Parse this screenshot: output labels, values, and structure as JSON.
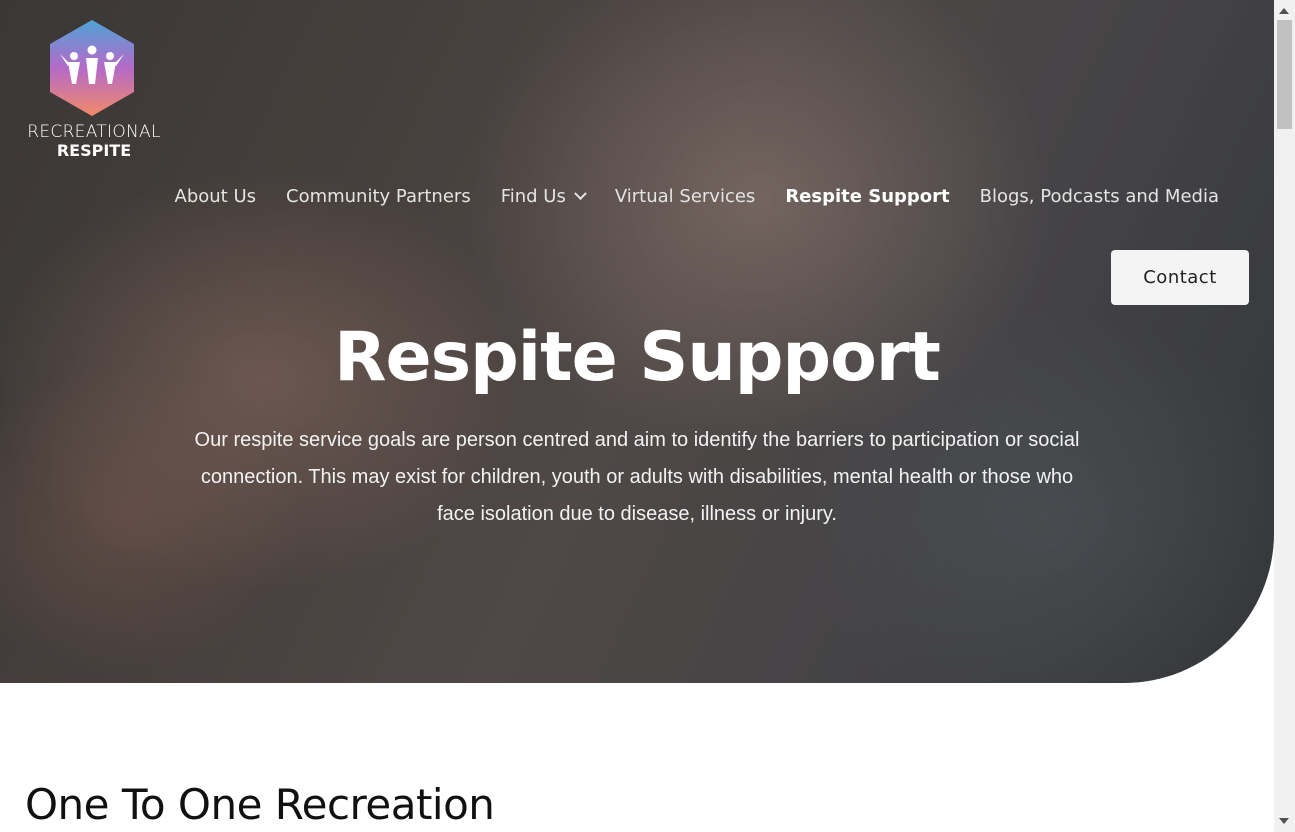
{
  "logo": {
    "line1": "RECREATIONAL",
    "line2": "RESPITE"
  },
  "nav": {
    "items": [
      {
        "label": "About Us"
      },
      {
        "label": "Community Partners"
      },
      {
        "label": "Find Us",
        "icon": "chevron-down-icon"
      },
      {
        "label": "Virtual Services"
      },
      {
        "label": "Respite Support",
        "active": true
      },
      {
        "label": "Blogs, Podcasts and Media"
      }
    ],
    "contact_label": "Contact"
  },
  "hero": {
    "title": "Respite Support",
    "text": "Our respite service goals are person centred and aim to identify the barriers to participation or social connection. This may exist for children, youth or adults with disabilities, mental health or those who face isolation due to disease, illness or injury."
  },
  "main": {
    "section_title": "One To One Recreation"
  },
  "colors": {
    "logo_top": "#4fa3d8",
    "logo_mid": "#b46ac8",
    "logo_bottom": "#f28a6a",
    "contact_bg": "#f4f4f4"
  }
}
